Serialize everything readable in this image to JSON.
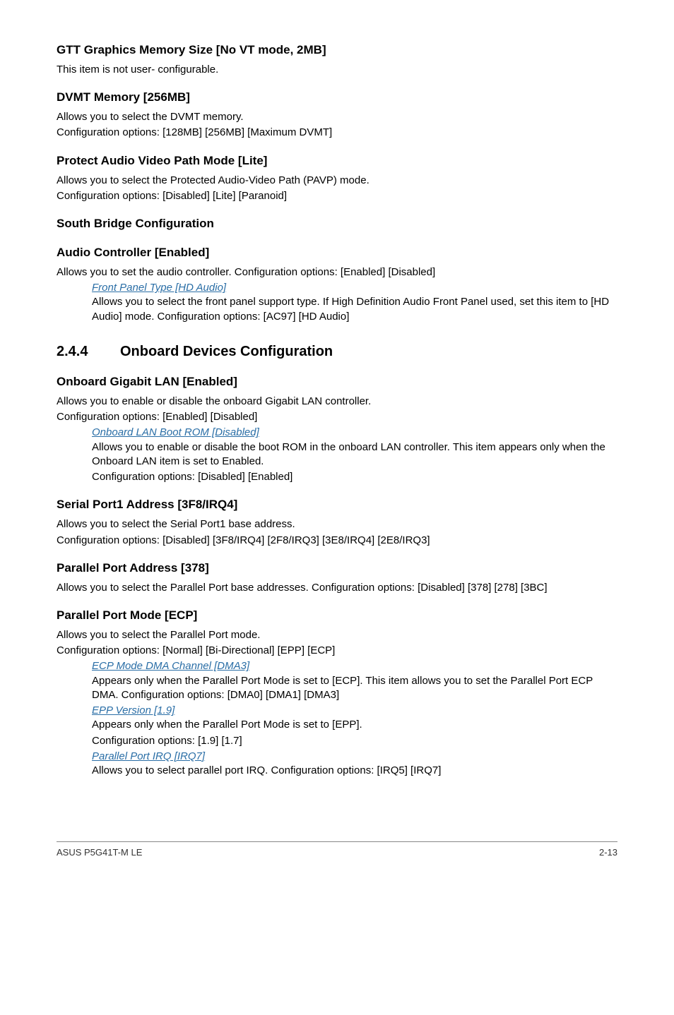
{
  "s1": {
    "h": "GTT Graphics Memory Size [No VT mode, 2MB]",
    "p1": "This item is not user- configurable."
  },
  "s2": {
    "h": "DVMT Memory [256MB]",
    "p1": "Allows you to select the DVMT memory.",
    "p2": "Configuration options: [128MB] [256MB] [Maximum DVMT]"
  },
  "s3": {
    "h": "Protect Audio Video Path Mode [Lite]",
    "p1": "Allows you to select the Protected Audio-Video Path (PAVP) mode.",
    "p2": "Configuration options: [Disabled] [Lite] [Paranoid]"
  },
  "s4": {
    "h": "South Bridge Configuration"
  },
  "s5": {
    "h": "Audio Controller [Enabled]",
    "p1": "Allows you to set the audio controller. Configuration options: [Enabled] [Disabled]",
    "sub": {
      "t": "Front Panel Type [HD Audio]",
      "p": "Allows you to select the front panel support type. If High Definition Audio Front Panel used, set this item to [HD Audio] mode. Configuration options: [AC97] [HD Audio]"
    }
  },
  "numbered": {
    "num": "2.4.4",
    "title": "Onboard Devices Configuration"
  },
  "s6": {
    "h": "Onboard Gigabit LAN [Enabled]",
    "p1": "Allows you to enable or disable the onboard Gigabit LAN controller.",
    "p2": "Configuration options: [Enabled] [Disabled]",
    "sub": {
      "t": "Onboard LAN Boot ROM [Disabled]",
      "p1": "Allows you to enable or disable the boot ROM in the onboard LAN controller. This item appears only when the Onboard LAN item is set to Enabled.",
      "p2": "Configuration options: [Disabled] [Enabled]"
    }
  },
  "s7": {
    "h": "Serial Port1 Address [3F8/IRQ4]",
    "p1": "Allows you to select the Serial Port1 base address.",
    "p2": "Configuration options: [Disabled] [3F8/IRQ4] [2F8/IRQ3] [3E8/IRQ4] [2E8/IRQ3]"
  },
  "s8": {
    "h": "Parallel Port Address [378]",
    "p1": "Allows you to select the Parallel Port base addresses. Configuration options: [Disabled] [378] [278] [3BC]"
  },
  "s9": {
    "h": "Parallel Port Mode [ECP]",
    "p1": "Allows you to select the Parallel Port mode.",
    "p2": "Configuration options: [Normal] [Bi-Directional] [EPP] [ECP]",
    "sub1": {
      "t": "ECP Mode DMA Channel [DMA3]",
      "p": "Appears only when the Parallel Port Mode is set to [ECP]. This item allows you to set the Parallel Port ECP DMA. Configuration options: [DMA0] [DMA1] [DMA3]"
    },
    "sub2": {
      "t": "EPP Version [1.9]",
      "p1": "Appears only when the Parallel Port Mode is set to [EPP].",
      "p2": "Configuration options: [1.9] [1.7]"
    },
    "sub3": {
      "t": "Parallel Port IRQ [IRQ7]",
      "p": "Allows you to select parallel port IRQ. Configuration options: [IRQ5] [IRQ7]"
    }
  },
  "footer": {
    "left": "ASUS P5G41T-M LE",
    "right": "2-13"
  }
}
